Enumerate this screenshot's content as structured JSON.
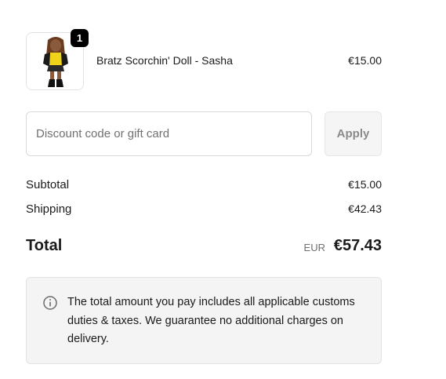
{
  "product": {
    "quantity": "1",
    "name": "Bratz Scorchin' Doll - Sasha",
    "price": "€15.00"
  },
  "discount": {
    "placeholder": "Discount code or gift card",
    "value": "",
    "apply_label": "Apply"
  },
  "summary": {
    "subtotal_label": "Subtotal",
    "subtotal_value": "€15.00",
    "shipping_label": "Shipping",
    "shipping_value": "€42.43",
    "total_label": "Total",
    "currency": "EUR",
    "total_value": "€57.43"
  },
  "notice": {
    "icon": "info-icon",
    "text": "The total amount you pay includes all applicable customs duties & taxes. We guarantee no additional charges on delivery."
  },
  "colors": {
    "text": "#1a1a1a",
    "muted": "#707070",
    "badge": "#000000",
    "info_bg": "#f4f4f4"
  }
}
